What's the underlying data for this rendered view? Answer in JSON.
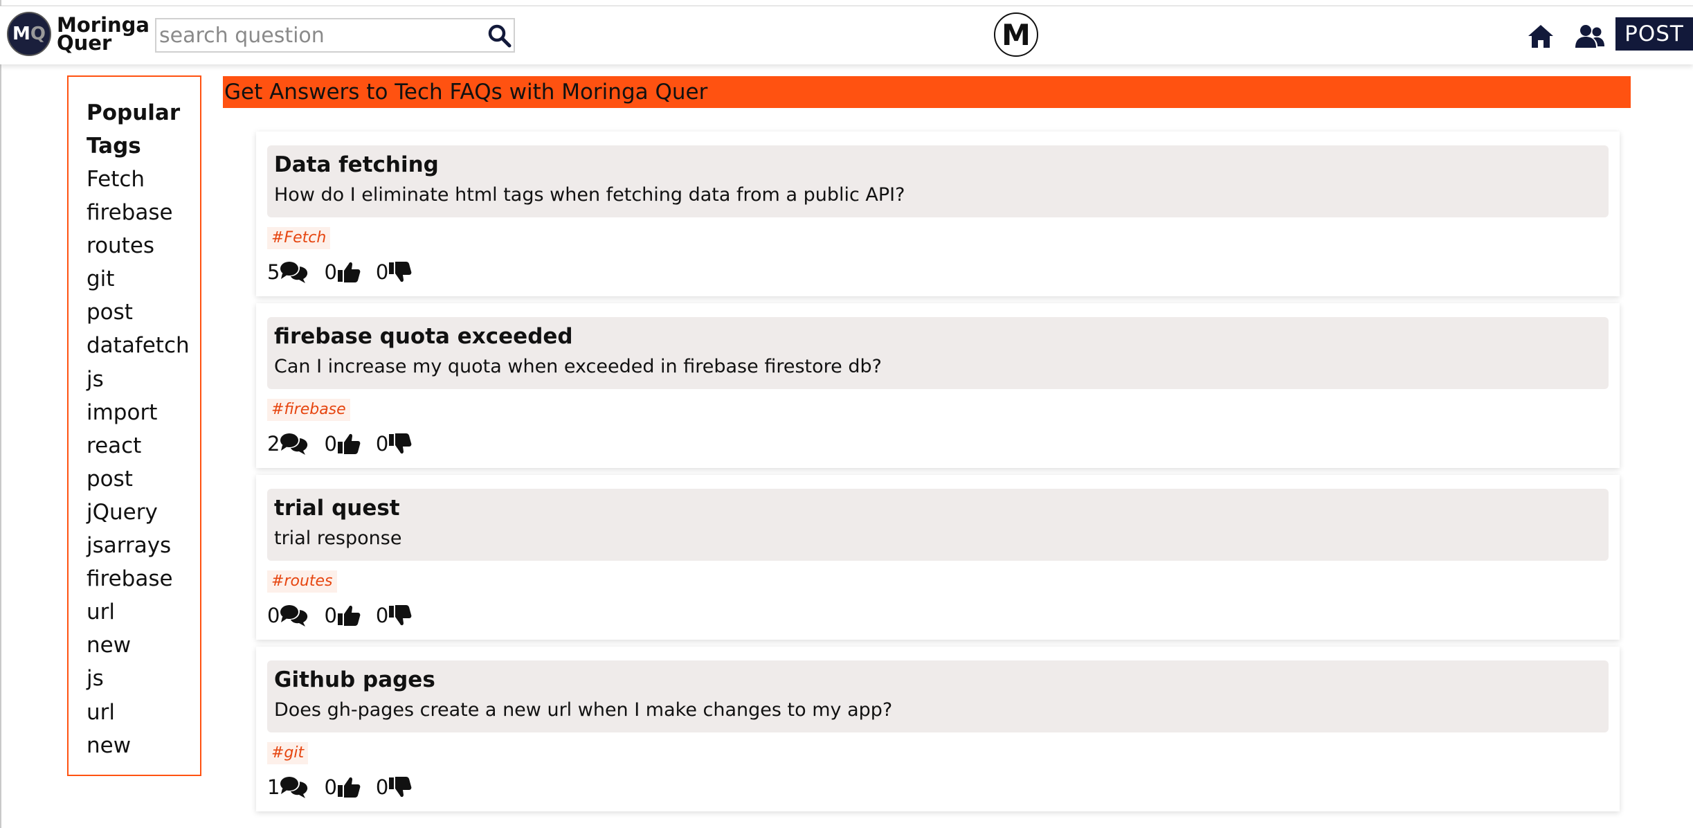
{
  "header": {
    "logo_letters": {
      "first": "M",
      "second": "Q"
    },
    "brand_line1": "Moringa",
    "brand_line2": "Quer",
    "search_placeholder": "search question",
    "center_logo_letter": "M",
    "post_label": "POST"
  },
  "sidebar": {
    "title_line1": "Popular",
    "title_line2": "Tags",
    "tags": [
      "Fetch",
      "firebase",
      "routes",
      "git",
      "post",
      "datafetch",
      "js",
      "import",
      "react",
      "post",
      "jQuery",
      "jsarrays",
      "firebase",
      "url",
      "new",
      "js",
      "url",
      "new"
    ]
  },
  "banner": {
    "text": "Get Answers to Tech FAQs with Moringa Quer"
  },
  "questions": [
    {
      "title": "Data fetching",
      "body": "How do I eliminate html tags when fetching data from a public API?",
      "tag": "#Fetch",
      "comments": "5",
      "likes": "0",
      "dislikes": "0"
    },
    {
      "title": "firebase quota exceeded",
      "body": "Can I increase my quota when exceeded in firebase firestore db?",
      "tag": "#firebase",
      "comments": "2",
      "likes": "0",
      "dislikes": "0"
    },
    {
      "title": "trial quest",
      "body": "trial response",
      "tag": "#routes",
      "comments": "0",
      "likes": "0",
      "dislikes": "0"
    },
    {
      "title": "Github pages",
      "body": "Does gh-pages create a new url when I make changes to my app?",
      "tag": "#git",
      "comments": "1",
      "likes": "0",
      "dislikes": "0"
    }
  ],
  "icons": {
    "search": "search-icon",
    "home": "home-icon",
    "users": "users-icon",
    "comments": "comments-icon",
    "like": "thumbs-up-icon",
    "dislike": "thumbs-down-icon"
  },
  "colors": {
    "accent": "#ff5211",
    "navy": "#12193a",
    "card_header": "#efebea",
    "tag_text": "#e6450f",
    "tag_bg": "#fdf0ea"
  }
}
